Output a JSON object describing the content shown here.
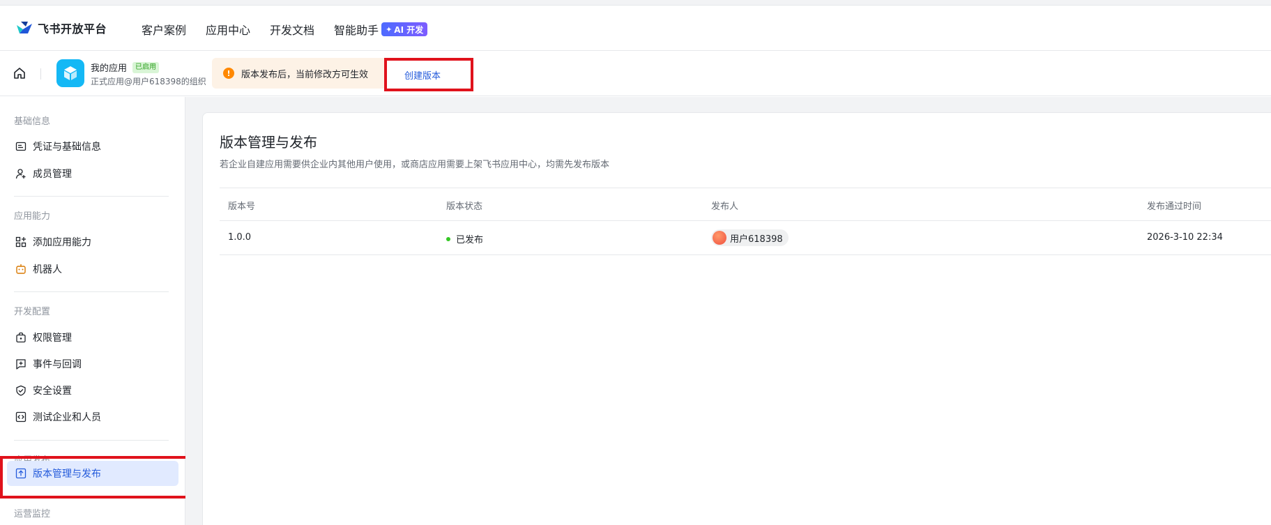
{
  "header": {
    "brand": "飞书开放平台",
    "nav": [
      "客户案例",
      "应用中心",
      "开发文档",
      "智能助手"
    ],
    "ai_badge": "AI 开发"
  },
  "subheader": {
    "app_name": "我的应用",
    "app_status": "已启用",
    "app_subtitle": "正式应用@用户618398的组织",
    "notice": "版本发布后，当前修改方可生效",
    "create_button": "创建版本"
  },
  "sidebar": {
    "sections": [
      {
        "title": "基础信息",
        "items": [
          "凭证与基础信息",
          "成员管理"
        ]
      },
      {
        "title": "应用能力",
        "items": [
          "添加应用能力",
          "机器人"
        ]
      },
      {
        "title": "开发配置",
        "items": [
          "权限管理",
          "事件与回调",
          "安全设置",
          "测试企业和人员"
        ]
      },
      {
        "title": "应用发布",
        "items": [
          "版本管理与发布"
        ]
      },
      {
        "title": "运营监控",
        "items": []
      }
    ],
    "active_item": "版本管理与发布"
  },
  "main": {
    "title": "版本管理与发布",
    "description": "若企业自建应用需要供企业内其他用户使用，或商店应用需要上架飞书应用中心，均需先发布版本",
    "columns": [
      "版本号",
      "版本状态",
      "发布人",
      "发布通过时间"
    ],
    "rows": [
      {
        "version": "1.0.0",
        "status": "已发布",
        "publisher": "用户618398",
        "time": "2026-3-10 22:34"
      }
    ]
  },
  "colors": {
    "accent": "#245bdb",
    "highlight_border": "#e0121c",
    "success": "#34c724",
    "warning": "#ff8800"
  }
}
